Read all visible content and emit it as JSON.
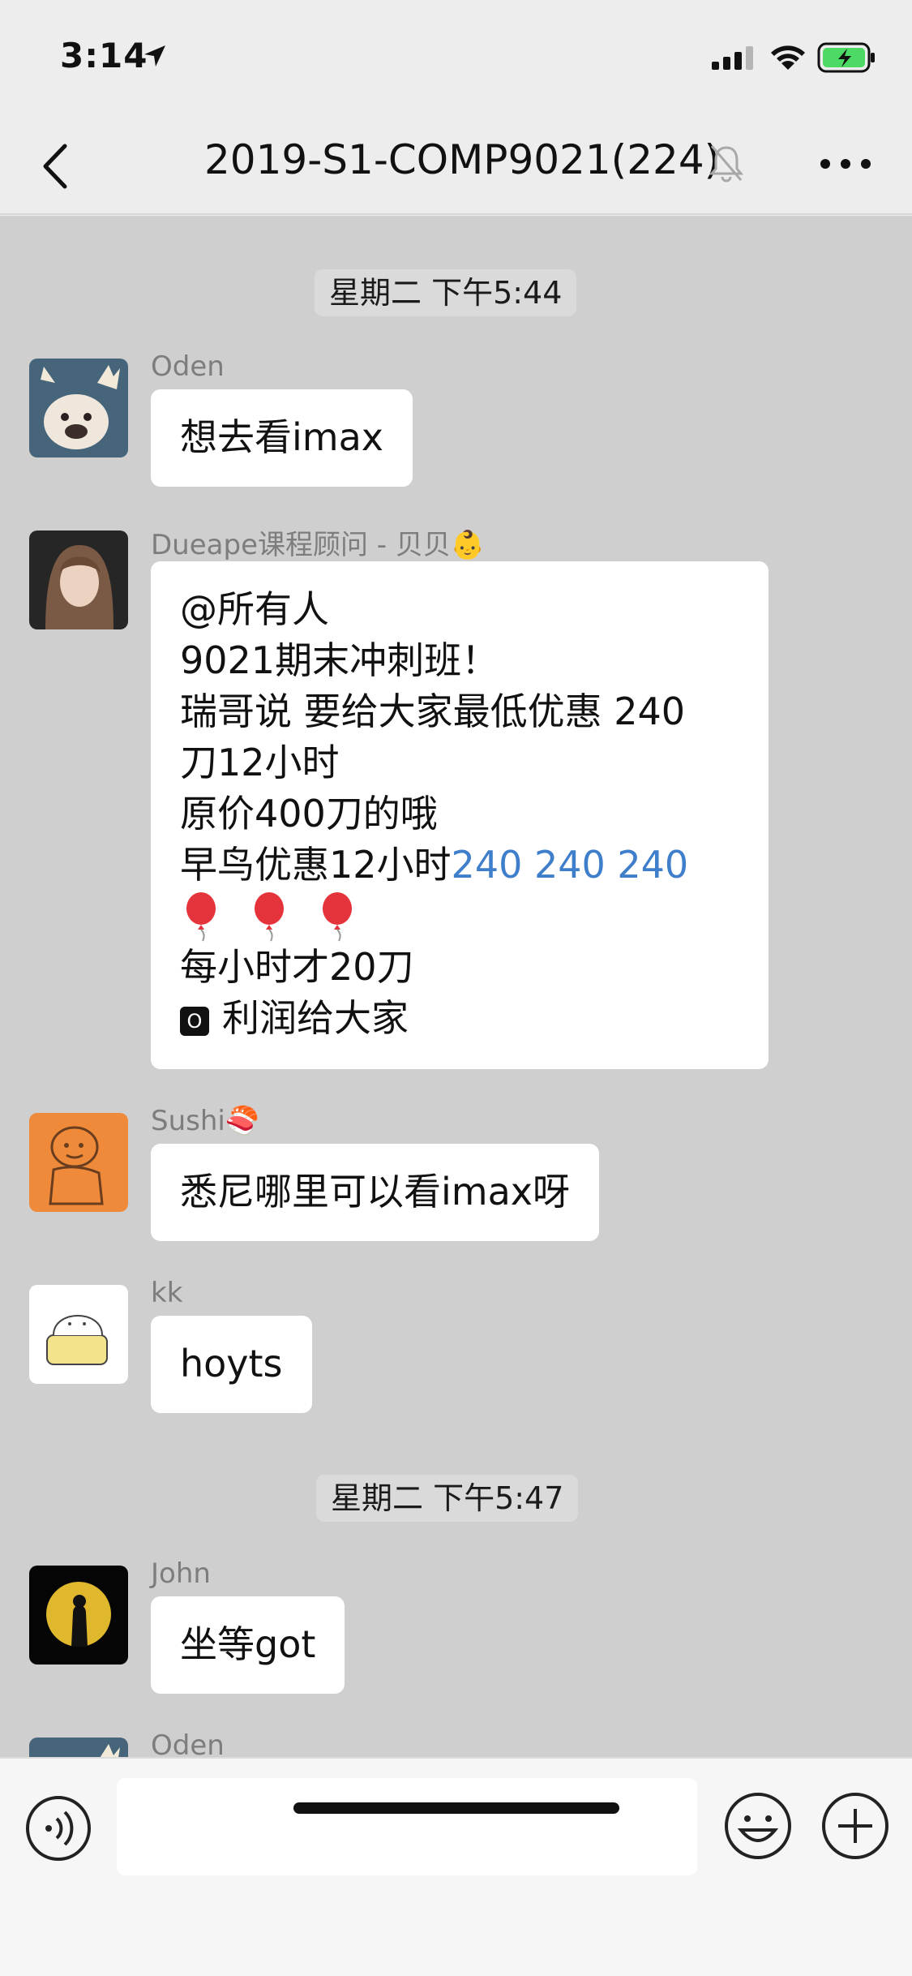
{
  "status_bar": {
    "time": "3:14",
    "icons": [
      "location-arrow-icon",
      "cellular-signal-icon",
      "wifi-icon",
      "battery-charging-icon"
    ]
  },
  "nav": {
    "title": "2019-S1-COMP9021(224)",
    "icons": [
      "back-chevron-icon",
      "mute-bell-icon",
      "more-ellipsis-icon"
    ]
  },
  "colors": {
    "chat_bg": "#cfcfcf",
    "bubble": "#ffffff",
    "link": "#3f7ecb",
    "battery": "#4cd964"
  },
  "chat": {
    "timestamps": [
      "星期二 下午5:44",
      "星期二 下午5:47"
    ],
    "messages": [
      {
        "sender": "Oden",
        "lines": [
          "想去看imax"
        ]
      },
      {
        "sender": "Dueape课程顾问 - 贝贝👶",
        "lines": [
          "@所有人",
          "9021期末冲刺班！",
          "瑞哥说 要给大家最低优惠 240",
          "刀12小时",
          "原价400刀的哦",
          "早鸟优惠12小时",
          "每小时才20刀",
          "利润给大家"
        ],
        "link_text": "240 240 240",
        "badge": "O",
        "emoji_row": "🎈 🎈 🎈"
      },
      {
        "sender": "Sushi🍣",
        "lines": [
          "悉尼哪里可以看imax呀"
        ]
      },
      {
        "sender": "kk",
        "lines": [
          "hoyts"
        ]
      },
      {
        "sender": "John",
        "lines": [
          "坐等got"
        ]
      },
      {
        "sender": "Oden",
        "lines": []
      }
    ]
  },
  "input_bar": {
    "icons": [
      "voice-icon",
      "emoji-icon",
      "plus-icon"
    ],
    "text": ""
  }
}
